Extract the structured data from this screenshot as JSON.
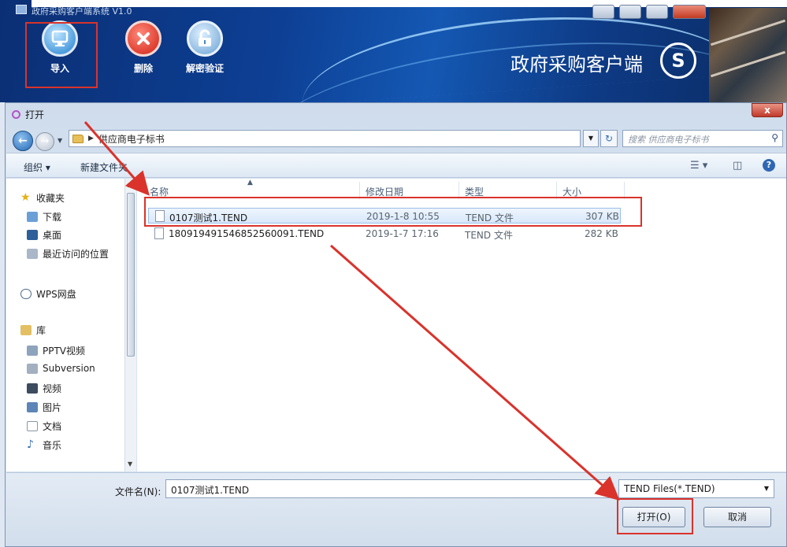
{
  "app": {
    "window_title": "政府采购客户端系统 V1.0",
    "brand": "政府采购客户端",
    "brand_logo": "S",
    "toolbar": [
      {
        "label": "导入",
        "icon": "monitor-icon"
      },
      {
        "label": "删除",
        "icon": "delete-x-icon"
      },
      {
        "label": "解密验证",
        "icon": "lock-icon"
      }
    ]
  },
  "dialog": {
    "title": "打开",
    "close_label": "x",
    "breadcrumb": "供应商电子标书",
    "search_placeholder": "搜索 供应商电子标书",
    "organize": "组织 ▾",
    "new_folder": "新建文件夹",
    "nav": {
      "favorites": "收藏夹",
      "favorites_items": [
        "下载",
        "桌面",
        "最近访问的位置"
      ],
      "wps": "WPS网盘",
      "library": "库",
      "library_items": [
        "PPTV视频",
        "Subversion",
        "视频",
        "图片",
        "文档",
        "音乐"
      ]
    },
    "columns": {
      "name": "名称",
      "date": "修改日期",
      "type": "类型",
      "size": "大小"
    },
    "files": [
      {
        "name": "0107测试1.TEND",
        "date": "2019-1-8 10:55",
        "type": "TEND 文件",
        "size": "307 KB"
      },
      {
        "name": "180919491546852560091.TEND",
        "date": "2019-1-7 17:16",
        "type": "TEND 文件",
        "size": "282 KB"
      }
    ],
    "filename_label": "文件名(N):",
    "filename_value": "0107测试1.TEND",
    "filetype": "TEND Files(*.TEND)",
    "open_button": "打开(O)",
    "cancel_button": "取消"
  },
  "colors": {
    "highlight": "#d9332b",
    "app_blue": "#0d3f94"
  }
}
